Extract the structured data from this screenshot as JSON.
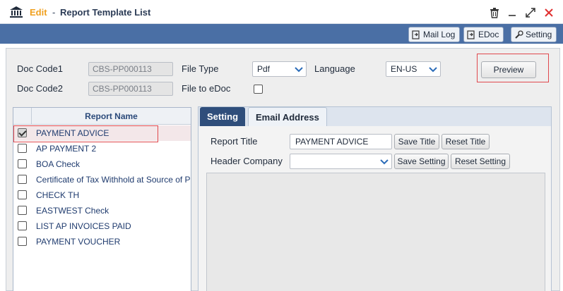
{
  "window": {
    "mode_label": "Edit",
    "separator": "-",
    "title": "Report Template List"
  },
  "toolbar": {
    "mail_log_label": "Mail Log",
    "edoc_label": "EDoc",
    "setting_label": "Setting"
  },
  "form": {
    "doc_code1_label": "Doc Code1",
    "doc_code1_value": "CBS-PP000113",
    "doc_code2_label": "Doc Code2",
    "doc_code2_value": "CBS-PP000113",
    "file_type_label": "File Type",
    "file_type_value": "Pdf",
    "file_to_edoc_label": "File to eDoc",
    "language_label": "Language",
    "language_value": "EN-US",
    "preview_label": "Preview"
  },
  "report_list": {
    "header": "Report Name",
    "items": [
      {
        "name": "PAYMENT ADVICE",
        "checked": true
      },
      {
        "name": "AP PAYMENT 2",
        "checked": false
      },
      {
        "name": "BOA Check",
        "checked": false
      },
      {
        "name": "Certificate of Tax Withhold at Source of Payment",
        "checked": false
      },
      {
        "name": "CHECK TH",
        "checked": false
      },
      {
        "name": "EASTWEST Check",
        "checked": false
      },
      {
        "name": "LIST AP INVOICES PAID",
        "checked": false
      },
      {
        "name": "PAYMENT VOUCHER",
        "checked": false
      }
    ]
  },
  "tabs": {
    "setting": "Setting",
    "email_address": "Email Address"
  },
  "setting": {
    "report_title_label": "Report Title",
    "report_title_value": "PAYMENT ADVICE",
    "save_title_label": "Save Title",
    "reset_title_label": "Reset Title",
    "header_company_label": "Header Company",
    "header_company_value": "",
    "save_setting_label": "Save Setting",
    "reset_setting_label": "Reset Setting"
  },
  "colors": {
    "accent_edit": "#f0a01e",
    "toolbar_bg": "#4a6fa5",
    "highlight_frame": "#e0484d",
    "close_icon": "#e03030"
  },
  "icons": [
    "bank-icon",
    "trash-icon",
    "minimize-icon",
    "maximize-icon",
    "close-icon",
    "mail-icon",
    "document-icon",
    "wrench-icon",
    "chevron-down-icon"
  ]
}
